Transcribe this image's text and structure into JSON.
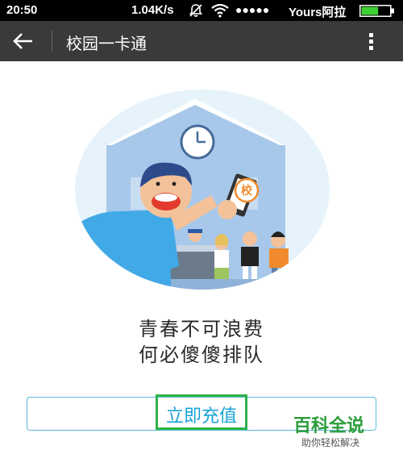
{
  "status_bar": {
    "time": "20:50",
    "speed": "1.04K/s",
    "signal": "●●●●●",
    "carrier": "Yours阿拉",
    "mute_icon": "mute-icon",
    "wifi_icon": "wifi-icon",
    "battery_icon": "battery-icon",
    "battery_level": 0.6,
    "battery_color": "#3ed134"
  },
  "app_bar": {
    "title": "校园一卡通",
    "back_icon": "arrow-left-icon",
    "more_icon": "more-vert-icon",
    "background": "#3a3a3a"
  },
  "illustration": {
    "card_badge": "校"
  },
  "slogan": {
    "line1": "青春不可浪费",
    "line2": "何必傻傻排队"
  },
  "recharge_button": {
    "label": "立即充值",
    "border_color": "#5fb8de",
    "text_color": "#1aa3d6",
    "highlight_color": "#2db34a"
  },
  "watermark": {
    "brand": "百科全说",
    "sub": "助你轻松解决"
  }
}
